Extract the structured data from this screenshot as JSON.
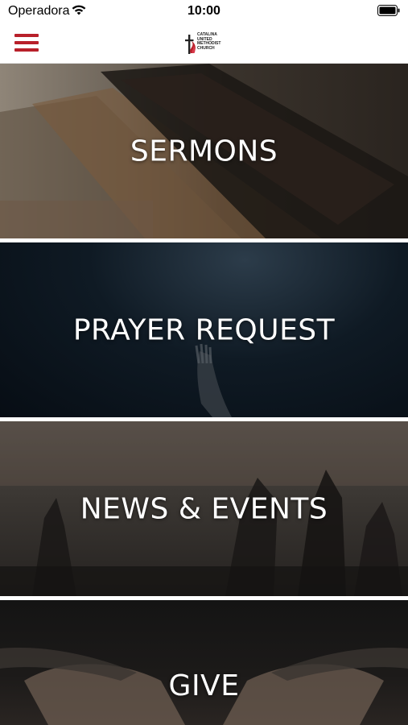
{
  "status_bar": {
    "carrier": "Operadora",
    "time": "10:00",
    "wifi_icon": "wifi-icon",
    "battery_icon": "battery-icon"
  },
  "header": {
    "menu_icon": "hamburger-menu-icon",
    "logo_text": "CATALINA\nUNITED\nMETHODIST\nCHURCH",
    "accent_color": "#b8202a"
  },
  "tiles": [
    {
      "label": "SERMONS"
    },
    {
      "label": "PRAYER REQUEST"
    },
    {
      "label": "NEWS & EVENTS"
    },
    {
      "label": "GIVE"
    }
  ]
}
